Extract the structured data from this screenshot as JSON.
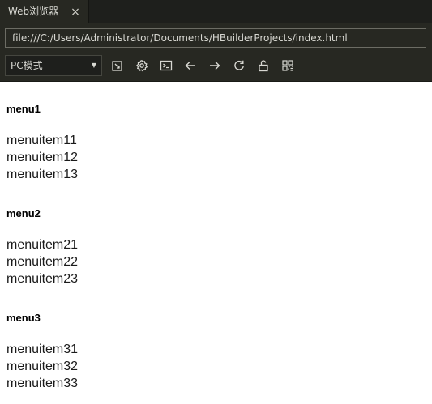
{
  "tabs": [
    {
      "label": "Web浏览器",
      "close": "×"
    }
  ],
  "address": {
    "url": "file:///C:/Users/Administrator/Documents/HBuilderProjects/index.html"
  },
  "toolbar": {
    "mode_select": {
      "value": "PC模式",
      "caret": "▼"
    },
    "icons": [
      "open-external-icon",
      "settings-icon",
      "console-icon",
      "back-arrow-icon",
      "forward-arrow-icon",
      "refresh-icon",
      "unlock-icon",
      "qr-code-icon"
    ]
  },
  "page": {
    "menus": [
      {
        "title": "menu1",
        "items": [
          "menuitem11",
          "menuitem12",
          "menuitem13"
        ]
      },
      {
        "title": "menu2",
        "items": [
          "menuitem21",
          "menuitem22",
          "menuitem23"
        ]
      },
      {
        "title": "menu3",
        "items": [
          "menuitem31",
          "menuitem32",
          "menuitem33"
        ]
      }
    ]
  },
  "colors": {
    "chrome_bg": "#272822",
    "tabbar_bg": "#1e1f1c",
    "chrome_text": "#d8d8d2",
    "page_bg": "#ffffff"
  }
}
